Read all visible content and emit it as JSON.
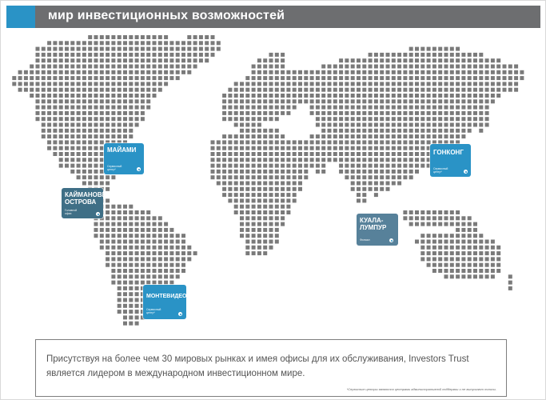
{
  "header": {
    "title": "мир инвестиционных возможностей",
    "bar_color": "#6d6e70",
    "accent_color": "#2a93c6"
  },
  "map": {
    "dot_color": "#7a7a7a",
    "offices": [
      {
        "id": "miami",
        "city": "МАЙАМИ",
        "type": "Сервисный\nцентр*",
        "color": "#2a93c6"
      },
      {
        "id": "cayman",
        "city": "КАЙМАНОВЫ\nОСТРОВА",
        "type": "Головной\nофис",
        "color": "#3f6f86"
      },
      {
        "id": "montevideo",
        "city": "МОНТЕВИДЕО",
        "type": "Сервисный\nцентр*",
        "color": "#2a93c6"
      },
      {
        "id": "hongkong",
        "city": "ГОНКОНГ",
        "type": "Сервисный\nцентр*",
        "color": "#2a93c6"
      },
      {
        "id": "kualalumpur",
        "city": "КУАЛА-\nЛУМПУР",
        "type": "Филиал",
        "color": "#57819a"
      }
    ]
  },
  "info": {
    "text": "Присутствуя на более чем 30 мировых рынках и имея офисы для их обслуживания, Investors Trust является лидером в международном инвестиционном мире.",
    "footnote": "*Сервисные центры являются центрами административной поддержки и не выпускают полисы."
  }
}
